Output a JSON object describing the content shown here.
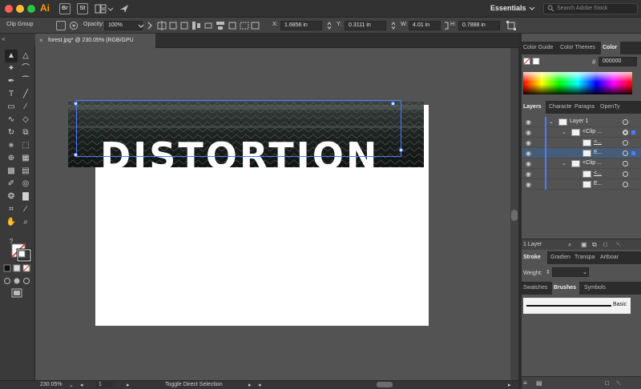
{
  "app": {
    "logo": "Ai",
    "bridge": "Br",
    "stock": "St",
    "workspace": "Essentials",
    "search_placeholder": "Search Adobe Stock"
  },
  "control": {
    "selection_type": "Clip Group",
    "opacity_label": "Opacity:",
    "opacity_value": "100%",
    "x_label": "X:",
    "x_value": "1.6856 in",
    "y_label": "Y:",
    "y_value": "0.3111 in",
    "w_label": "W:",
    "w_value": "4.01 in",
    "h_label": "H:",
    "h_value": "0.7888 in"
  },
  "document": {
    "tab_title": "forest.jpg* @ 230.05% (RGB/GPU Preview)",
    "close": "×",
    "artwork_text": "DISTORTION"
  },
  "status": {
    "zoom": "230.05%",
    "artboard": "1",
    "tool_hint": "Toggle Direct Selection"
  },
  "color_panel": {
    "tabs": [
      "Color Guide",
      "Color Themes",
      "Color"
    ],
    "hex_symbol": "#",
    "hex_value": "000000"
  },
  "layers_panel": {
    "tabs": [
      "Layers",
      "Characte",
      "Paragra",
      "OpenTy"
    ],
    "rows": [
      {
        "name": "Layer 1"
      },
      {
        "name": "<Clip ..."
      },
      {
        "name": "<..."
      },
      {
        "name": "E..."
      },
      {
        "name": "<Clip ..."
      },
      {
        "name": "<..."
      },
      {
        "name": "E..."
      }
    ],
    "footer": "1 Layer"
  },
  "stroke_panel": {
    "tabs": [
      "Stroke",
      "Gradien",
      "Transpa",
      "Artboar"
    ],
    "weight_label": "Weight:"
  },
  "brushes_panel": {
    "tabs": [
      "Swatches",
      "Brushes",
      "Symbols"
    ],
    "brush_name": "Basic"
  },
  "colors": {
    "accent": "#4a7cff",
    "ui_dark": "#323232",
    "canvas": "#535353"
  }
}
